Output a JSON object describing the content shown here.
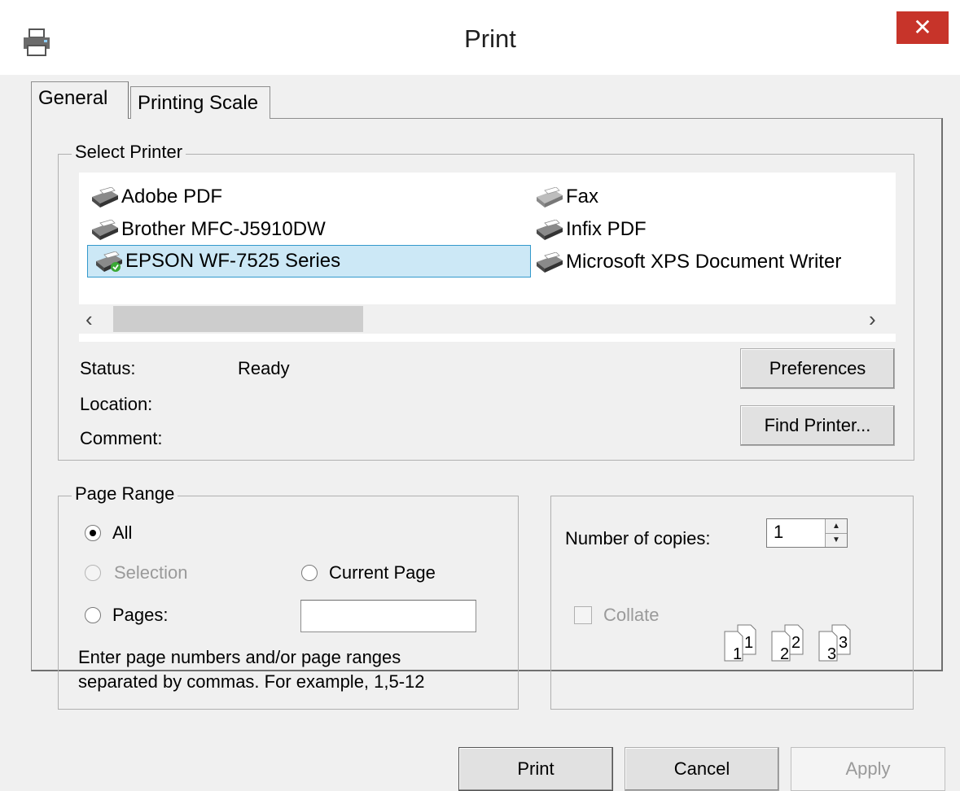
{
  "window": {
    "title": "Print",
    "close_glyph": "✕"
  },
  "tabs": [
    {
      "label": "General",
      "active": true
    },
    {
      "label": "Printing Scale",
      "active": false
    }
  ],
  "select_printer": {
    "legend": "Select Printer",
    "printers": [
      {
        "name": "Adobe PDF",
        "icon": "printer-icon",
        "selected": false
      },
      {
        "name": "Brother MFC-J5910DW",
        "icon": "printer-icon",
        "selected": false
      },
      {
        "name": "EPSON WF-7525 Series",
        "icon": "printer-default-icon",
        "selected": true
      },
      {
        "name": "Fax",
        "icon": "fax-icon",
        "selected": false
      },
      {
        "name": "Infix PDF",
        "icon": "printer-icon",
        "selected": false
      },
      {
        "name": "Microsoft XPS Document Writer",
        "icon": "printer-icon",
        "selected": false
      }
    ],
    "scroll_left_glyph": "‹",
    "scroll_right_glyph": "›",
    "status_label": "Status:",
    "status_value": "Ready",
    "location_label": "Location:",
    "comment_label": "Comment:",
    "preferences_label": "Preferences",
    "find_printer_label": "Find Printer..."
  },
  "page_range": {
    "legend": "Page Range",
    "all_label": "All",
    "selection_label": "Selection",
    "current_page_label": "Current Page",
    "pages_label": "Pages:",
    "pages_value": "",
    "hint_line1": "Enter page numbers and/or page ranges",
    "hint_line2": "separated by commas.  For example, 1,5-12",
    "selected_option": "All"
  },
  "copies": {
    "label": "Number of copies:",
    "value": "1",
    "up_glyph": "▲",
    "down_glyph": "▼",
    "collate_label": "Collate",
    "collate_checked": false,
    "collate_pages": [
      "1",
      "1",
      "2",
      "2",
      "3",
      "3"
    ]
  },
  "buttons": {
    "print": "Print",
    "cancel": "Cancel",
    "apply": "Apply"
  },
  "colors": {
    "close_red": "#c7342a",
    "selection_blue": "#cce8f6",
    "selection_border": "#3399cc",
    "dialog_bg": "#f0f0f0"
  }
}
